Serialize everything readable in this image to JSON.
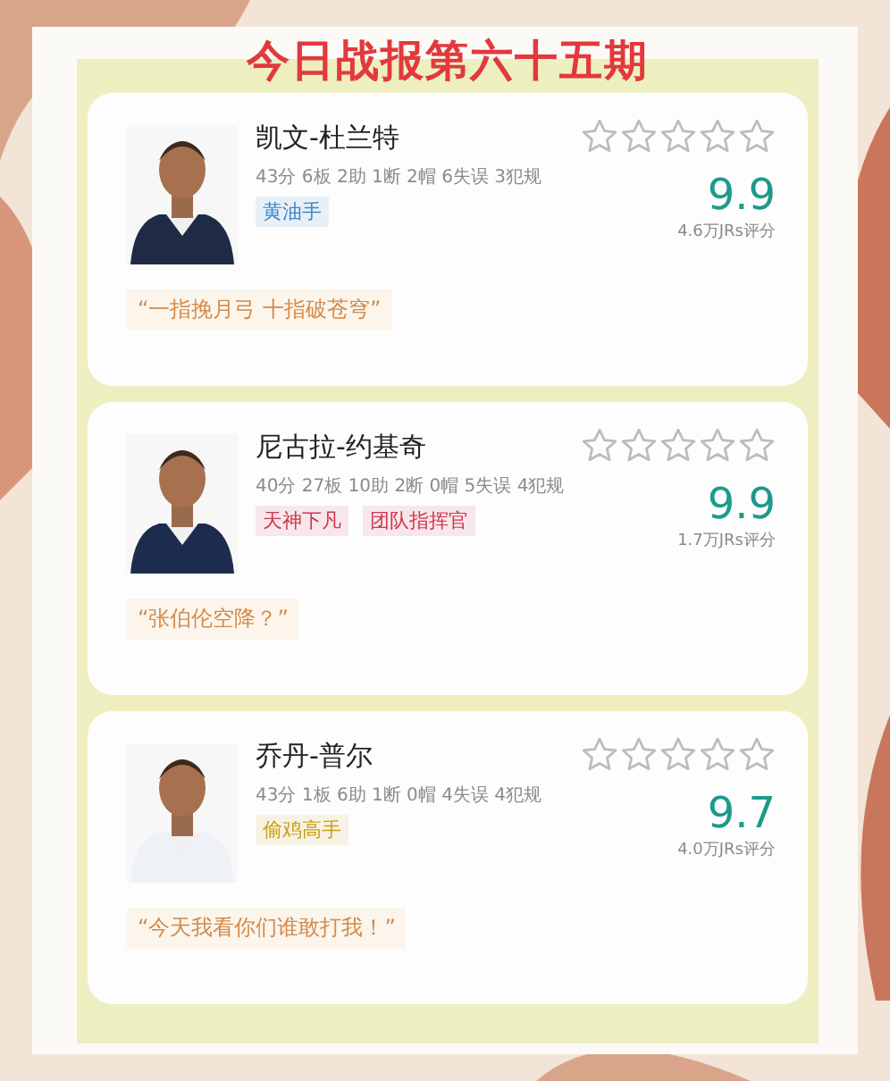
{
  "title": "今日战报第六十五期",
  "players": [
    {
      "name": "凯文-杜兰特",
      "stats": "43分 6板 2助 1断 2帽 6失误 3犯规",
      "tags": [
        {
          "label": "黄油手",
          "color": "#3f86c6"
        }
      ],
      "stars": 0,
      "score": "9.9",
      "votes": "4.6万JRs评分",
      "quote": "“一指挽月弓 十指破苍穹”"
    },
    {
      "name": "尼古拉-约基奇",
      "stats": "40分 27板 10助 2断 0帽 5失误 4犯规",
      "tags": [
        {
          "label": "天神下凡",
          "color": "#d0364f"
        },
        {
          "label": "团队指挥官",
          "color": "#d0364f"
        }
      ],
      "stars": 0,
      "score": "9.9",
      "votes": "1.7万JRs评分",
      "quote": "“张伯伦空降？”"
    },
    {
      "name": "乔丹-普尔",
      "stats": "43分 1板 6助 1断 0帽 4失误 4犯规",
      "tags": [
        {
          "label": "偷鸡高手",
          "color": "#c9a01a"
        }
      ],
      "stars": 0,
      "score": "9.7",
      "votes": "4.0万JRs评分",
      "quote": "“今天我看你们谁敢打我！”"
    }
  ]
}
